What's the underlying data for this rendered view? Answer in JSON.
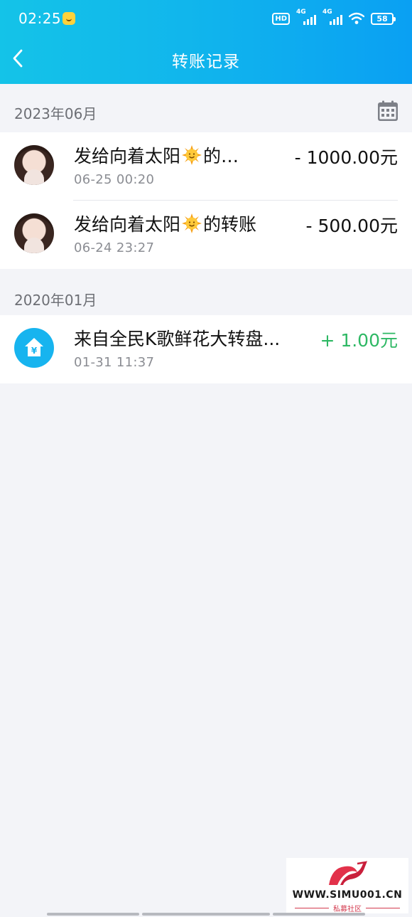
{
  "status_bar": {
    "time": "02:25",
    "hd_label": "HD",
    "network_1": "4G",
    "network_2": "4G",
    "battery": "58"
  },
  "nav": {
    "title": "转账记录",
    "back_icon": "chevron-left-icon"
  },
  "sections": [
    {
      "month": "2023年06月",
      "calendar_icon": "calendar-icon",
      "items": [
        {
          "title_prefix": "发给向着太阳",
          "title_suffix": "的…",
          "time": "06-25 00:20",
          "amount": "- 1000.00元"
        },
        {
          "title_prefix": "发给向着太阳",
          "title_suffix": "的转账",
          "time": "06-24 23:27",
          "amount": "- 500.00元"
        }
      ]
    },
    {
      "month": "2020年01月",
      "items": [
        {
          "title": "来自全民K歌鲜花大转盘...",
          "time": "01-31 11:37",
          "amount": "+ 1.00元"
        }
      ]
    }
  ],
  "watermark": {
    "url": "WWW.SIMU001.CN",
    "name": "私募社区"
  },
  "colors": {
    "header_start": "#14c3e8",
    "header_end": "#0aa0f3",
    "income": "#2eb864",
    "background": "#f3f4f8"
  }
}
